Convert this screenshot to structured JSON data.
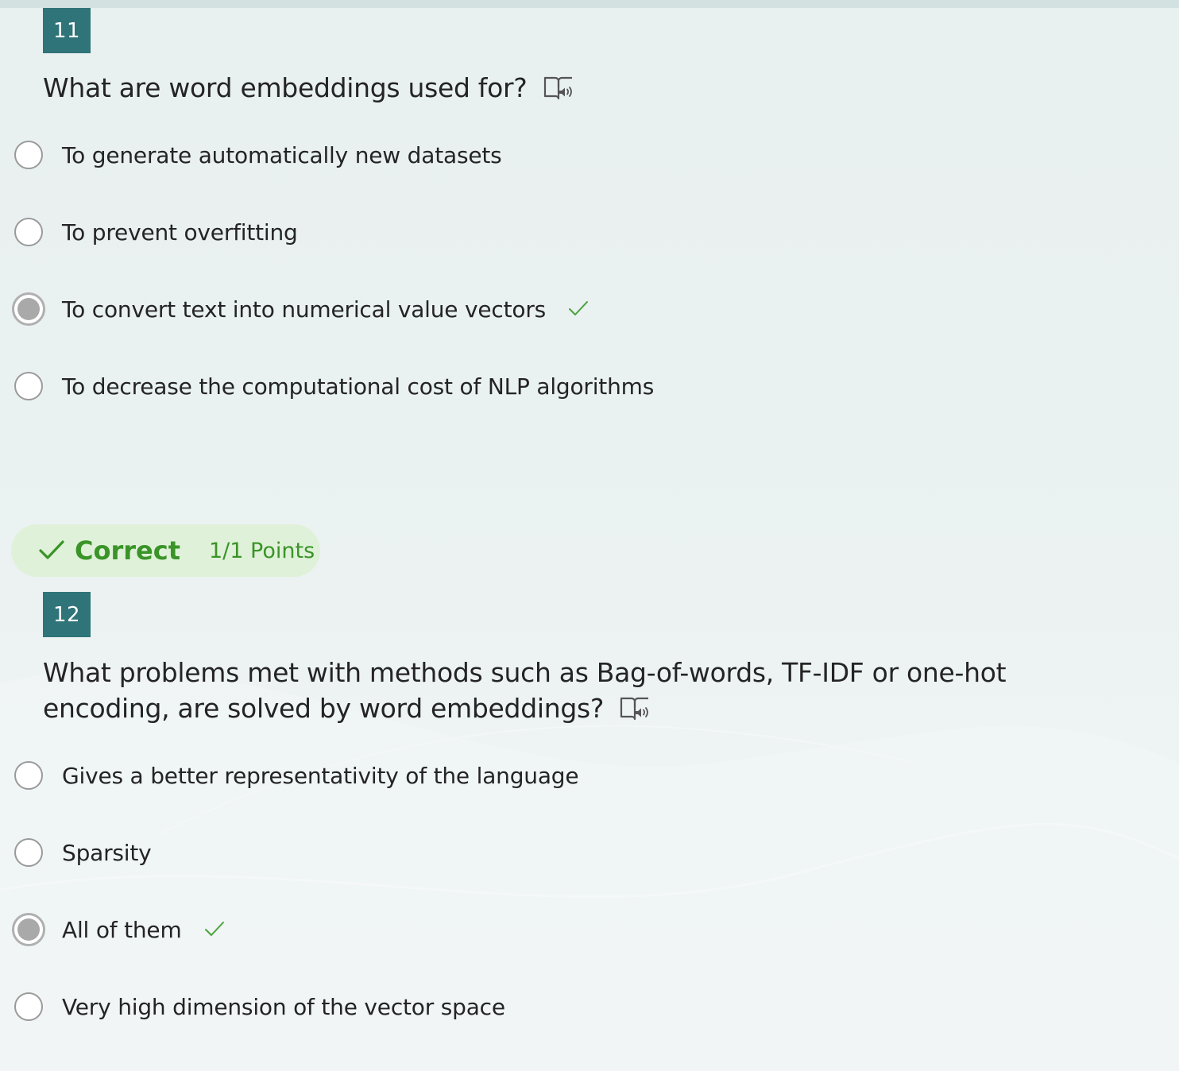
{
  "questions": [
    {
      "number": "11",
      "text": "What are word embeddings used for?",
      "choices": [
        {
          "label": "To generate automatically new datasets",
          "selected": false,
          "correct": false
        },
        {
          "label": "To prevent overfitting",
          "selected": false,
          "correct": false
        },
        {
          "label": "To convert text into numerical value vectors",
          "selected": true,
          "correct": true
        },
        {
          "label": "To decrease the computational cost of NLP algorithms",
          "selected": false,
          "correct": false
        }
      ]
    },
    {
      "number": "12",
      "text": "What problems met with methods such as Bag-of-words, TF-IDF or one-hot encoding, are solved by word embeddings?",
      "choices": [
        {
          "label": "Gives a better representativity of the language",
          "selected": false,
          "correct": false
        },
        {
          "label": "Sparsity",
          "selected": false,
          "correct": false
        },
        {
          "label": "All of them",
          "selected": true,
          "correct": true
        },
        {
          "label": "Very high dimension of the vector space",
          "selected": false,
          "correct": false
        }
      ]
    }
  ],
  "feedback": {
    "status": "Correct",
    "points": "1/1 Points"
  },
  "icons": {
    "immersive_reader": "immersive-reader-icon",
    "correct_tick": "checkmark-icon"
  },
  "colors": {
    "question_number_bg": "#2f7479",
    "correct_green": "#3a9428",
    "feedback_bg": "#dff1d8",
    "tick_green": "#4aa33a"
  }
}
